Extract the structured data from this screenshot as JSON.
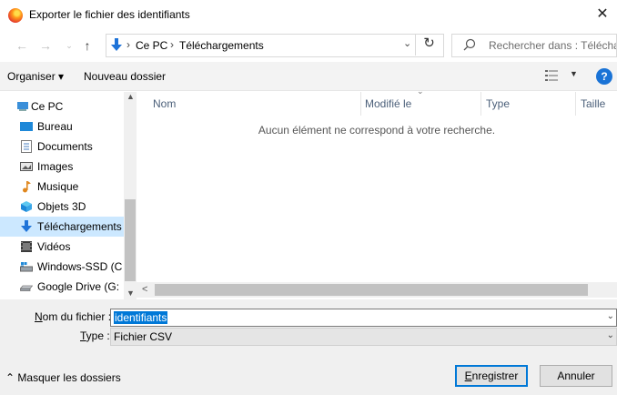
{
  "window": {
    "title": "Exporter le fichier des identifiants"
  },
  "address": {
    "crumbs": [
      "Ce PC",
      "Téléchargements"
    ],
    "search_placeholder": "Rechercher dans : Télécharge..."
  },
  "toolbar": {
    "organize": "Organiser ▾",
    "new_folder": "Nouveau dossier"
  },
  "nav": {
    "items": [
      {
        "label": "Ce PC",
        "icon": "pc-icon"
      },
      {
        "label": "Bureau",
        "icon": "desktop-folder-icon"
      },
      {
        "label": "Documents",
        "icon": "documents-icon"
      },
      {
        "label": "Images",
        "icon": "images-icon"
      },
      {
        "label": "Musique",
        "icon": "music-icon"
      },
      {
        "label": "Objets 3D",
        "icon": "objects3d-icon"
      },
      {
        "label": "Téléchargements",
        "icon": "downloads-icon",
        "selected": true
      },
      {
        "label": "Vidéos",
        "icon": "videos-icon"
      },
      {
        "label": "Windows-SSD (C",
        "icon": "drive-c-icon"
      },
      {
        "label": "Google Drive (G:",
        "icon": "drive-g-icon"
      }
    ]
  },
  "list": {
    "columns": [
      "Nom",
      "Modifié le",
      "Type",
      "Taille"
    ],
    "empty_message": "Aucun élément ne correspond à votre recherche."
  },
  "form": {
    "filename_label_prefix": "N",
    "filename_label_rest": "om du fichier :",
    "filename_value": "identifiants",
    "type_label_prefix": "T",
    "type_label_rest": "ype :",
    "type_value": "Fichier CSV"
  },
  "footer": {
    "hide_folders": "Masquer les dossiers",
    "save_prefix": "E",
    "save_rest": "nregistrer",
    "cancel": "Annuler"
  },
  "colors": {
    "accent": "#0078d7",
    "selection": "#cce8ff",
    "help": "#1a73d6"
  }
}
